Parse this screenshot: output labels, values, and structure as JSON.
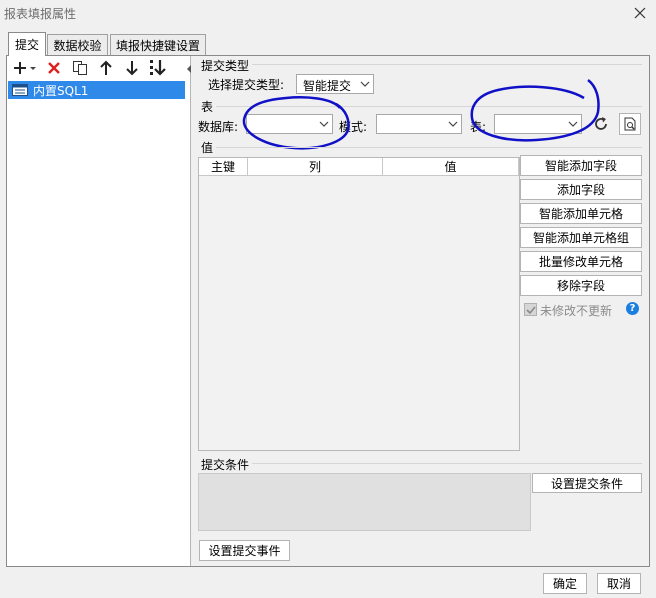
{
  "window": {
    "title": "报表填报属性"
  },
  "tabs": [
    {
      "label": "提交"
    },
    {
      "label": "数据校验"
    },
    {
      "label": "填报快捷键设置"
    }
  ],
  "tree": {
    "items": [
      {
        "label": "内置SQL1"
      }
    ]
  },
  "submit_type": {
    "section_label": "提交类型",
    "select_label": "选择提交类型:",
    "selected": "智能提交"
  },
  "table": {
    "section_label": "表",
    "database_label": "数据库:",
    "database_value": "",
    "schema_label": "模式:",
    "schema_value": "",
    "table_label": "表:",
    "table_value": ""
  },
  "values": {
    "section_label": "值",
    "columns": [
      "主键",
      "列",
      "值"
    ],
    "buttons": {
      "smart_add_field": "智能添加字段",
      "add_field": "添加字段",
      "smart_add_cell": "智能添加单元格",
      "smart_add_cell_group": "智能添加单元格组",
      "batch_modify_cells": "批量修改单元格",
      "remove_field": "移除字段"
    },
    "no_update_label": "未修改不更新"
  },
  "conditions": {
    "section_label": "提交条件",
    "set_button": "设置提交条件"
  },
  "event_button": "设置提交事件",
  "footer": {
    "ok": "确定",
    "cancel": "取消"
  },
  "colors": {
    "selection": "#2e89e8",
    "delete": "#e02020",
    "annotation": "#1010c8",
    "help": "#1a7fe0"
  }
}
